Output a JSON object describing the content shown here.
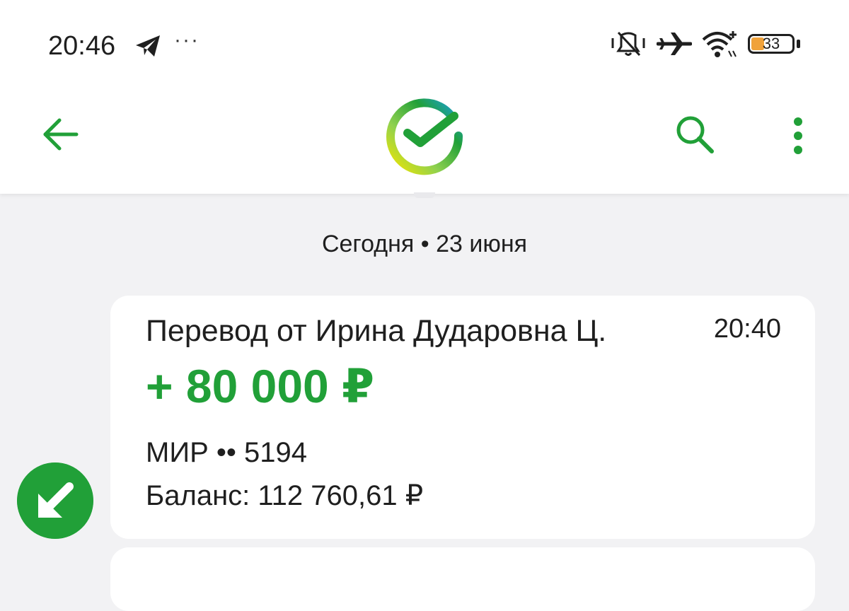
{
  "status_bar": {
    "time": "20:46",
    "overflow_indicator": "···",
    "battery_level": "33",
    "battery_fraction": 0.33,
    "icons": [
      "telegram-icon",
      "vibrate-muted-icon",
      "airplane-icon",
      "wifi-icon",
      "battery-icon"
    ]
  },
  "nav": {
    "back_icon": "arrow-left-icon",
    "logo": "sber-logo",
    "search_icon": "search-icon",
    "menu_icon": "more-vertical-icon"
  },
  "feed": {
    "date_label": "Сегодня • 23 июня",
    "transactions": [
      {
        "title": "Перевод от Ирина Дударовна Ц.",
        "time": "20:40",
        "amount": "+ 80 000 ₽",
        "card": "МИР •• 5194",
        "balance": "Баланс: 112 760,61 ₽",
        "direction_icon": "incoming-arrow-icon"
      }
    ]
  },
  "colors": {
    "accent": "#21a038",
    "background": "#f2f2f4",
    "card": "#ffffff",
    "battery": "#f0a23a"
  }
}
